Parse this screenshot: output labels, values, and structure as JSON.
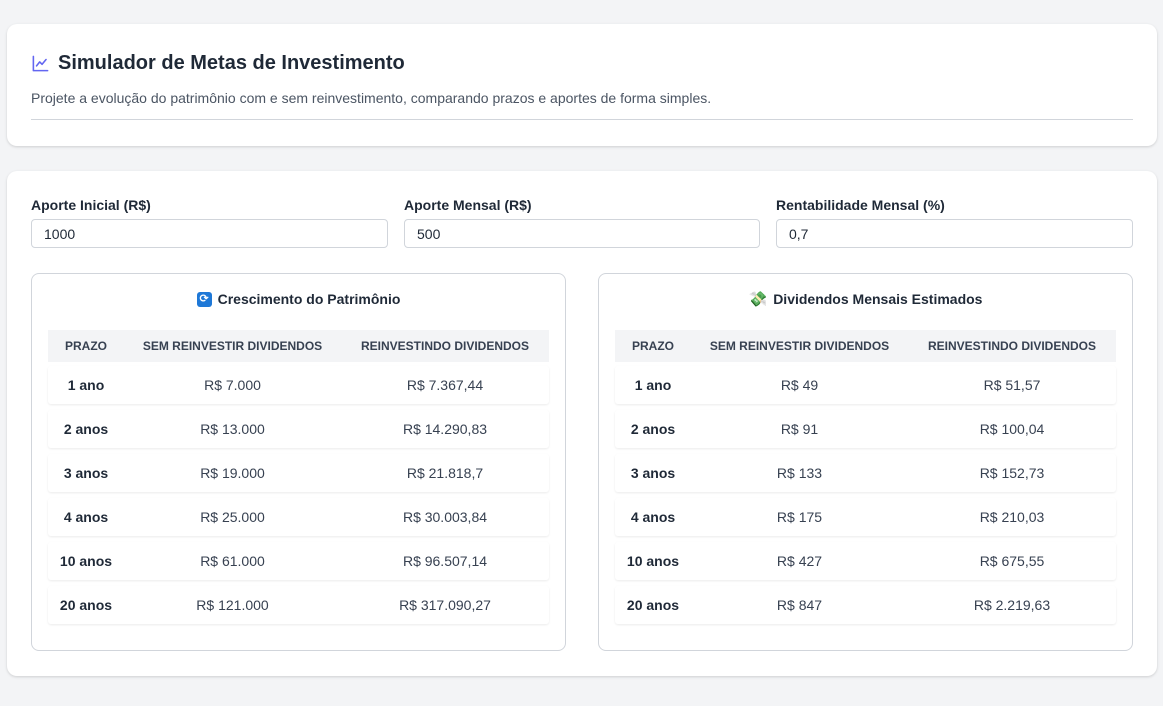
{
  "header": {
    "title": "Simulador de Metas de Investimento",
    "subtitle": "Projete a evolução do patrimônio com e sem reinvestimento, comparando prazos e aportes de forma simples.",
    "accent_color": "#6366f1",
    "icon": "line-chart-icon"
  },
  "inputs": {
    "aporte_inicial": {
      "label": "Aporte Inicial (R$)",
      "value": "1000"
    },
    "aporte_mensal": {
      "label": "Aporte Mensal (R$)",
      "value": "500"
    },
    "rentabilidade": {
      "label": "Rentabilidade Mensal (%)",
      "value": "0,7"
    }
  },
  "patrimonio": {
    "icon": "refresh-icon",
    "icon_glyph": "🔄",
    "title": "Crescimento do Patrimônio",
    "headers": [
      "PRAZO",
      "SEM REINVESTIR DIVIDENDOS",
      "REINVESTINDO DIVIDENDOS"
    ],
    "rows": [
      [
        "1 ano",
        "R$ 7.000",
        "R$ 7.367,44"
      ],
      [
        "2 anos",
        "R$ 13.000",
        "R$ 14.290,83"
      ],
      [
        "3 anos",
        "R$ 19.000",
        "R$ 21.818,7"
      ],
      [
        "4 anos",
        "R$ 25.000",
        "R$ 30.003,84"
      ],
      [
        "10 anos",
        "R$ 61.000",
        "R$ 96.507,14"
      ],
      [
        "20 anos",
        "R$ 121.000",
        "R$ 317.090,27"
      ]
    ]
  },
  "dividendos": {
    "icon": "money-icon",
    "icon_glyph": "💸",
    "title": "Dividendos Mensais Estimados",
    "headers": [
      "PRAZO",
      "SEM REINVESTIR DIVIDENDOS",
      "REINVESTINDO DIVIDENDOS"
    ],
    "rows": [
      [
        "1 ano",
        "R$ 49",
        "R$ 51,57"
      ],
      [
        "2 anos",
        "R$ 91",
        "R$ 100,04"
      ],
      [
        "3 anos",
        "R$ 133",
        "R$ 152,73"
      ],
      [
        "4 anos",
        "R$ 175",
        "R$ 210,03"
      ],
      [
        "10 anos",
        "R$ 427",
        "R$ 675,55"
      ],
      [
        "20 anos",
        "R$ 847",
        "R$ 2.219,63"
      ]
    ]
  }
}
